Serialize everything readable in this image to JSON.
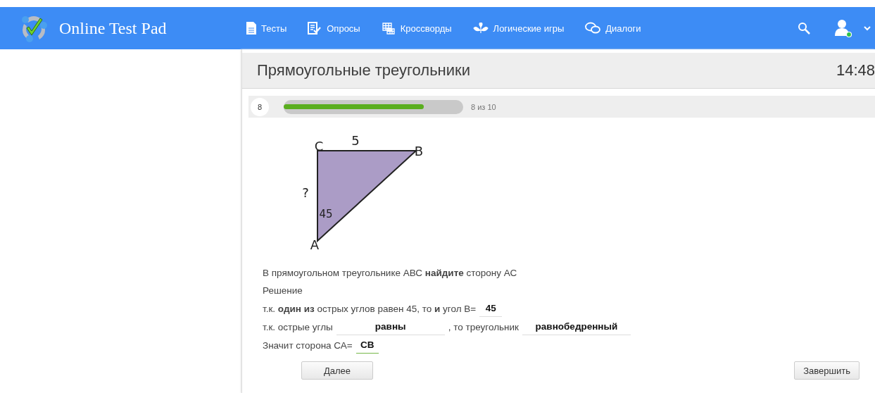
{
  "header": {
    "logo": "Online Test Pad",
    "nav": [
      {
        "label": "Тесты"
      },
      {
        "label": "Опросы"
      },
      {
        "label": "Кроссворды"
      },
      {
        "label": "Логические игры"
      },
      {
        "label": "Диалоги"
      }
    ]
  },
  "test": {
    "title": "Прямоугольные треугольники",
    "timer": "14:48",
    "question_number": "8",
    "progress": {
      "level": 0.78,
      "text": "8 из 10"
    }
  },
  "figure": {
    "labels": [
      "C",
      "5",
      "B",
      "?",
      "45",
      "A"
    ]
  },
  "question": "В прямоугольном треугольнике АВС **найдите** сторону АС",
  "solution_label": "Решение",
  "lines": [
    [
      {
        "kind": "text",
        "text": "т.к. **один из** острых углов равен 45, то **и**  угол В="
      },
      {
        "kind": "field",
        "value": "45",
        "focused": false
      }
    ],
    [
      {
        "kind": "text",
        "text": "т.к. острые углы"
      },
      {
        "kind": "field",
        "value": "равны",
        "focused": false
      },
      {
        "kind": "text",
        "text": ", то треугольник"
      },
      {
        "kind": "field",
        "value": "равнобедренный",
        "focused": false
      }
    ],
    [
      {
        "kind": "text",
        "text": "Значит сторона СА="
      },
      {
        "kind": "field",
        "value": "СВ",
        "focused": true
      }
    ]
  ],
  "buttons": {
    "next": "Далее",
    "finish": "Завершить"
  }
}
